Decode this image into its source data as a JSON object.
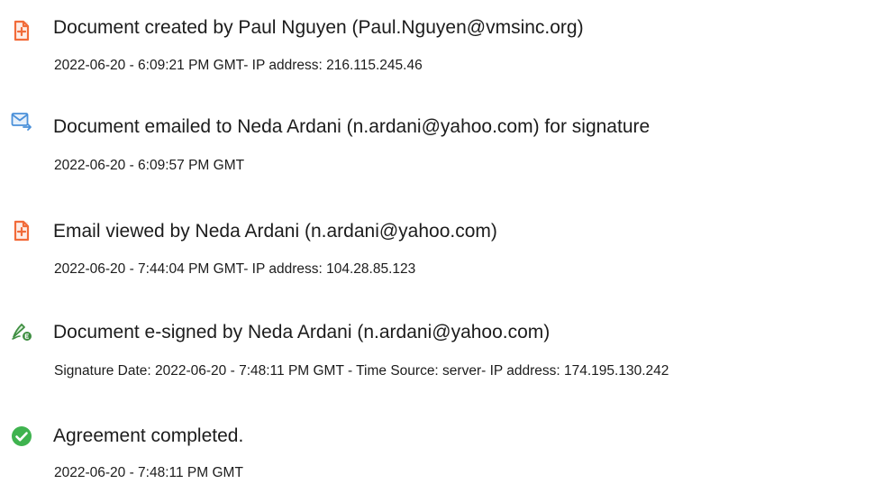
{
  "audit_events": [
    {
      "icon": "document-created-icon",
      "title": "Document created by Paul Nguyen (Paul.Nguyen@vmsinc.org)",
      "detail": "2022-06-20 - 6:09:21 PM GMT- IP address: 216.115.245.46"
    },
    {
      "icon": "email-sent-icon",
      "title": "Document emailed to Neda Ardani (n.ardani@yahoo.com) for signature",
      "detail": "2022-06-20 - 6:09:57 PM GMT"
    },
    {
      "icon": "email-viewed-icon",
      "title": "Email viewed by Neda Ardani (n.ardani@yahoo.com)",
      "detail": "2022-06-20 - 7:44:04 PM GMT- IP address: 104.28.85.123"
    },
    {
      "icon": "e-signature-icon",
      "title": "Document e-signed by Neda Ardani (n.ardani@yahoo.com)",
      "detail": "Signature Date: 2022-06-20 - 7:48:11 PM GMT - Time Source: server- IP address: 174.195.130.242"
    },
    {
      "icon": "checkmark-circle-icon",
      "title": "Agreement completed.",
      "detail": "2022-06-20 - 7:48:11 PM GMT"
    }
  ],
  "colors": {
    "document_icon": "#f26b3a",
    "email_icon": "#4a90d9",
    "signature_icon": "#3e8e41",
    "check_icon": "#3fb34f",
    "text": "#1c1c1c"
  }
}
